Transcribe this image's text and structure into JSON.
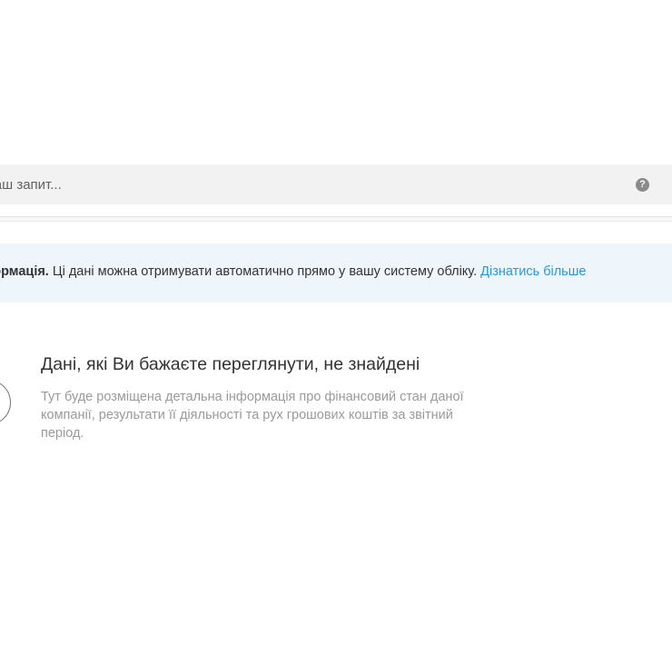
{
  "search": {
    "placeholder": "ь ваш запит...",
    "help_icon": "?"
  },
  "banner": {
    "bold_text": "інформація.",
    "text": " Ці дані можна отримувати автоматично прямо у вашу систему обліку. ",
    "link": "Дізнатись більше"
  },
  "empty_state": {
    "title": "Дані, які Ви бажаєте переглянути, не знайдені",
    "description": "Тут буде розміщена детальна інформація про фінансовий стан даної компанії, результати її діяльності та рух грошових коштів за звітний період.",
    "icon": "circle-icon"
  },
  "colors": {
    "link": "#2a98d6",
    "banner_bg": "#eef6fc",
    "search_bg": "#f2f2f2"
  }
}
